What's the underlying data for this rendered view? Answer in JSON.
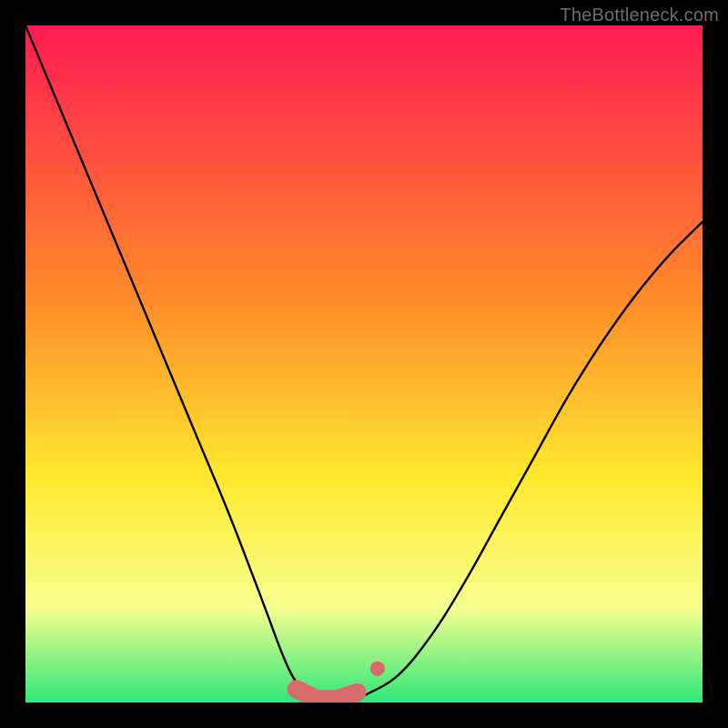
{
  "watermark": "TheBottleneck.com",
  "colors": {
    "frame": "#000000",
    "gradient_top": "#ff1a52",
    "gradient_mid1": "#ff8a2a",
    "gradient_mid2": "#ffe92e",
    "gradient_mid3": "#f6ff8f",
    "gradient_bottom": "#2fe87a",
    "curve": "#000000",
    "marker": "#d86b6b"
  },
  "chart_data": {
    "type": "line",
    "title": "",
    "xlabel": "",
    "ylabel": "",
    "xlim": [
      0,
      100
    ],
    "ylim": [
      0,
      100
    ],
    "series": [
      {
        "name": "bottleneck-curve",
        "x": [
          0,
          5,
          10,
          15,
          20,
          25,
          30,
          35,
          38,
          40,
          42,
          44,
          46,
          48,
          50,
          55,
          60,
          65,
          70,
          75,
          80,
          85,
          90,
          95,
          100
        ],
        "y": [
          100,
          88,
          76,
          64,
          52,
          40,
          28,
          15,
          7,
          3,
          1,
          0,
          0,
          0,
          1,
          4,
          10,
          18,
          27,
          36,
          45,
          53,
          60,
          66,
          71
        ]
      }
    ],
    "markers": [
      {
        "name": "plateau-left",
        "x": 40,
        "y": 2
      },
      {
        "name": "plateau-mid1",
        "x": 43,
        "y": 0.5
      },
      {
        "name": "plateau-mid2",
        "x": 46,
        "y": 0.5
      },
      {
        "name": "plateau-right",
        "x": 49,
        "y": 1.5
      },
      {
        "name": "upper-dot",
        "x": 52,
        "y": 5
      }
    ]
  }
}
